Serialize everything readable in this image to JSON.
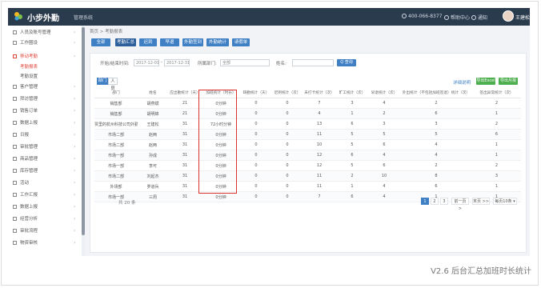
{
  "app": {
    "brand": "小步外勤",
    "subtitle": "管理系统"
  },
  "topbar": {
    "phone": "400-066-8377",
    "help": "帮助中心",
    "notify": "通知",
    "exit": "退出",
    "user": "王建松 ▾"
  },
  "sidebar": {
    "items": [
      {
        "label": "人员及账号管理"
      },
      {
        "label": "工作圈设"
      },
      {
        "label": "移动考勤"
      },
      {
        "label": "客户管理"
      },
      {
        "label": "拜访管理"
      },
      {
        "label": "销售订单"
      },
      {
        "label": "数据上报"
      },
      {
        "label": "日报"
      },
      {
        "label": "审批管理"
      },
      {
        "label": "商品管理"
      },
      {
        "label": "库存管理"
      },
      {
        "label": "活动"
      },
      {
        "label": "工作汇报"
      },
      {
        "label": "数据上报"
      },
      {
        "label": "经营分析"
      },
      {
        "label": "审批流程"
      },
      {
        "label": "物资审核"
      }
    ],
    "subitems": [
      {
        "label": "考勤报表"
      },
      {
        "label": "考勤设置"
      }
    ]
  },
  "breadcrumb": "首页 > 考勤报表",
  "tabs": [
    {
      "label": "全部"
    },
    {
      "label": "考勤汇总"
    },
    {
      "label": "迟到"
    },
    {
      "label": "早退"
    },
    {
      "label": "外勤签到"
    },
    {
      "label": "外勤统计"
    },
    {
      "label": "请假单"
    }
  ],
  "filters": {
    "date_label": "开始/结束时间:",
    "date_from": "2017-12-01",
    "date_to": "2017-12-31",
    "dept_label": "所属部门:",
    "dept_value": "全部",
    "name_label": "姓名:",
    "name_placeholder": "",
    "query_button": "Q 查询"
  },
  "view_toggle": {
    "a": "部门",
    "b": "人员"
  },
  "actions": {
    "detail_link": "详细说明",
    "export": "导出Excel",
    "more": "导出月报"
  },
  "table": {
    "headers": [
      "部门",
      "姓名",
      "应出勤统计（天）",
      "加班统计（时长）",
      "缺勤统计（天）",
      "迟到统计（次）",
      "未打卡统计（次）",
      "旷工统计（次）",
      "早退统计（次）",
      "外出统计（不包括加班签退）统计（次）",
      "签出异常统计（次）"
    ],
    "rows": [
      [
        "销售部",
        "胡燕斌",
        "21",
        "0分钟",
        "0",
        "0",
        "7",
        "3",
        "4",
        "2",
        "2"
      ],
      [
        "销售部",
        "胡明锦",
        "21",
        "0分钟",
        "0",
        "0",
        "4",
        "1",
        "2",
        "6",
        "1"
      ],
      [
        "贾里的杭州科技公司外勤",
        "王建松",
        "31",
        "72小时分钟",
        "0",
        "0",
        "13",
        "6",
        "3",
        "3",
        "2"
      ],
      [
        "市场二部",
        "赵两",
        "31",
        "0分钟",
        "0",
        "0",
        "11",
        "5",
        "5",
        "5",
        "6"
      ],
      [
        "市场二部",
        "赵两",
        "31",
        "0分钟",
        "0",
        "0",
        "10",
        "5",
        "6",
        "4",
        "1"
      ],
      [
        "市场一部",
        "孙成",
        "31",
        "0分钟",
        "0",
        "0",
        "12",
        "6",
        "4",
        "4",
        "1"
      ],
      [
        "市场一部",
        "李可",
        "31",
        "0分钟",
        "0",
        "0",
        "12",
        "5",
        "6",
        "2",
        "2"
      ],
      [
        "市场二部",
        "刘起杰",
        "31",
        "0分钟",
        "0",
        "0",
        "11",
        "2",
        "10",
        "8",
        "3"
      ],
      [
        "外场部",
        "罗道兵",
        "31",
        "0分钟",
        "0",
        "0",
        "11",
        "1",
        "4",
        "6",
        "1"
      ],
      [
        "市场一部",
        "三周",
        "31",
        "0分钟",
        "0",
        "0",
        "7",
        "6",
        "4",
        "1",
        "1"
      ]
    ]
  },
  "pagination": {
    "total": "共 20 条",
    "pages": [
      "1",
      "2",
      "3"
    ],
    "prev": "前一页 >",
    "last": "末页 >>",
    "per_page": "每页10条 ▾"
  },
  "caption": "V2.6 后台汇总加班时长统计",
  "colors": {
    "topbar": "#2b3b4e",
    "accent": "#3f7fc4",
    "green": "#4cae4c",
    "highlight": "#d9312b"
  }
}
